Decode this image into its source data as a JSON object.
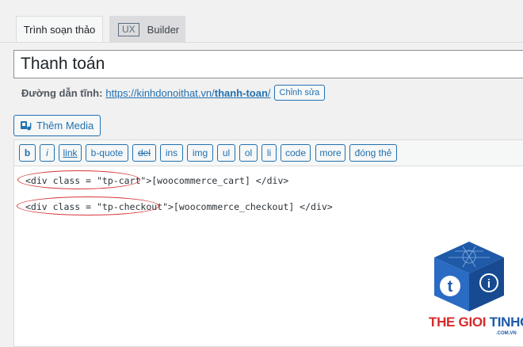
{
  "tabs": {
    "editor_label": "Trình soạn thảo",
    "ux_logo": "UX",
    "builder_label": "Builder"
  },
  "post": {
    "title": "Thanh toán"
  },
  "permalink": {
    "label": "Đường dẫn tĩnh:",
    "base_url": "https://kinhdonoithat.vn/",
    "slug": "thanh-toan",
    "trailing": "/",
    "edit_label": "Chỉnh sửa"
  },
  "media": {
    "add_media_label": "Thêm Media"
  },
  "toolbar": {
    "buttons": [
      "b",
      "i",
      "link",
      "b-quote",
      "del",
      "ins",
      "img",
      "ul",
      "ol",
      "li",
      "code",
      "more",
      "đóng thẻ"
    ]
  },
  "content": {
    "line1": "<div class = \"tp-cart\">[woocommerce_cart] </div>",
    "line2": "<div class = \"tp-checkout\">[woocommerce_checkout] </div>"
  },
  "watermark": {
    "brand_part1": "THE GIOI",
    "brand_part2": "TINHOC",
    "domain": ".COM.VN",
    "colors": {
      "red": "#d62a2a",
      "blue": "#1e5aa8"
    }
  },
  "colors": {
    "accent": "#2271b1",
    "highlight": "#d63638"
  }
}
